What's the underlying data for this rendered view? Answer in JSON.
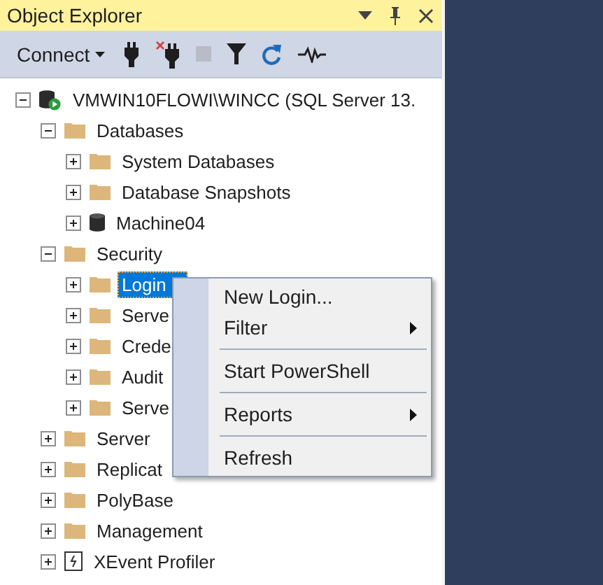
{
  "panel": {
    "title": "Object Explorer"
  },
  "title_buttons": [
    {
      "kind": "dropdown"
    },
    {
      "kind": "pin"
    },
    {
      "kind": "close"
    }
  ],
  "toolbar": [
    {
      "kind": "connect",
      "label": "Connect",
      "disabled": false
    },
    {
      "kind": "plug",
      "disabled": false
    },
    {
      "kind": "unplug",
      "disabled": false
    },
    {
      "kind": "stop",
      "disabled": true
    },
    {
      "kind": "filter",
      "disabled": false
    },
    {
      "kind": "refresh",
      "disabled": false
    },
    {
      "kind": "activity",
      "disabled": false
    }
  ],
  "tree": [
    {
      "label": "VMWIN10FLOWI\\WINCC (SQL Server 13.",
      "kind": "server",
      "expanded": true,
      "selected": false,
      "children": [
        {
          "label": "Databases",
          "kind": "folder",
          "expanded": true,
          "selected": false,
          "children": [
            {
              "label": "System Databases",
              "kind": "folder",
              "expanded": false,
              "selected": false
            },
            {
              "label": "Database Snapshots",
              "kind": "folder",
              "expanded": false,
              "selected": false
            },
            {
              "label": "Machine04",
              "kind": "database",
              "expanded": false,
              "selected": false
            }
          ]
        },
        {
          "label": "Security",
          "kind": "folder",
          "expanded": true,
          "selected": false,
          "children": [
            {
              "label": "Login",
              "kind": "folder",
              "expanded": false,
              "selected": true
            },
            {
              "label": "Serve",
              "kind": "folder",
              "expanded": false,
              "selected": false
            },
            {
              "label": "Crede",
              "kind": "folder",
              "expanded": false,
              "selected": false
            },
            {
              "label": "Audit",
              "kind": "folder",
              "expanded": false,
              "selected": false
            },
            {
              "label": "Serve",
              "kind": "folder",
              "expanded": false,
              "selected": false
            }
          ]
        },
        {
          "label": "Server",
          "kind": "folder",
          "expanded": false,
          "selected": false
        },
        {
          "label": "Replicat",
          "kind": "folder",
          "expanded": false,
          "selected": false
        },
        {
          "label": "PolyBase",
          "kind": "folder",
          "expanded": false,
          "selected": false
        },
        {
          "label": "Management",
          "kind": "folder",
          "expanded": false,
          "selected": false
        },
        {
          "label": "XEvent Profiler",
          "kind": "xevent",
          "expanded": false,
          "selected": false
        }
      ]
    }
  ],
  "context_menu": [
    {
      "kind": "item",
      "label": "New Login...",
      "submenu": false
    },
    {
      "kind": "item",
      "label": "Filter",
      "submenu": true
    },
    {
      "kind": "separator"
    },
    {
      "kind": "item",
      "label": "Start PowerShell",
      "submenu": false
    },
    {
      "kind": "separator"
    },
    {
      "kind": "item",
      "label": "Reports",
      "submenu": true
    },
    {
      "kind": "separator"
    },
    {
      "kind": "item",
      "label": "Refresh",
      "submenu": false
    }
  ]
}
